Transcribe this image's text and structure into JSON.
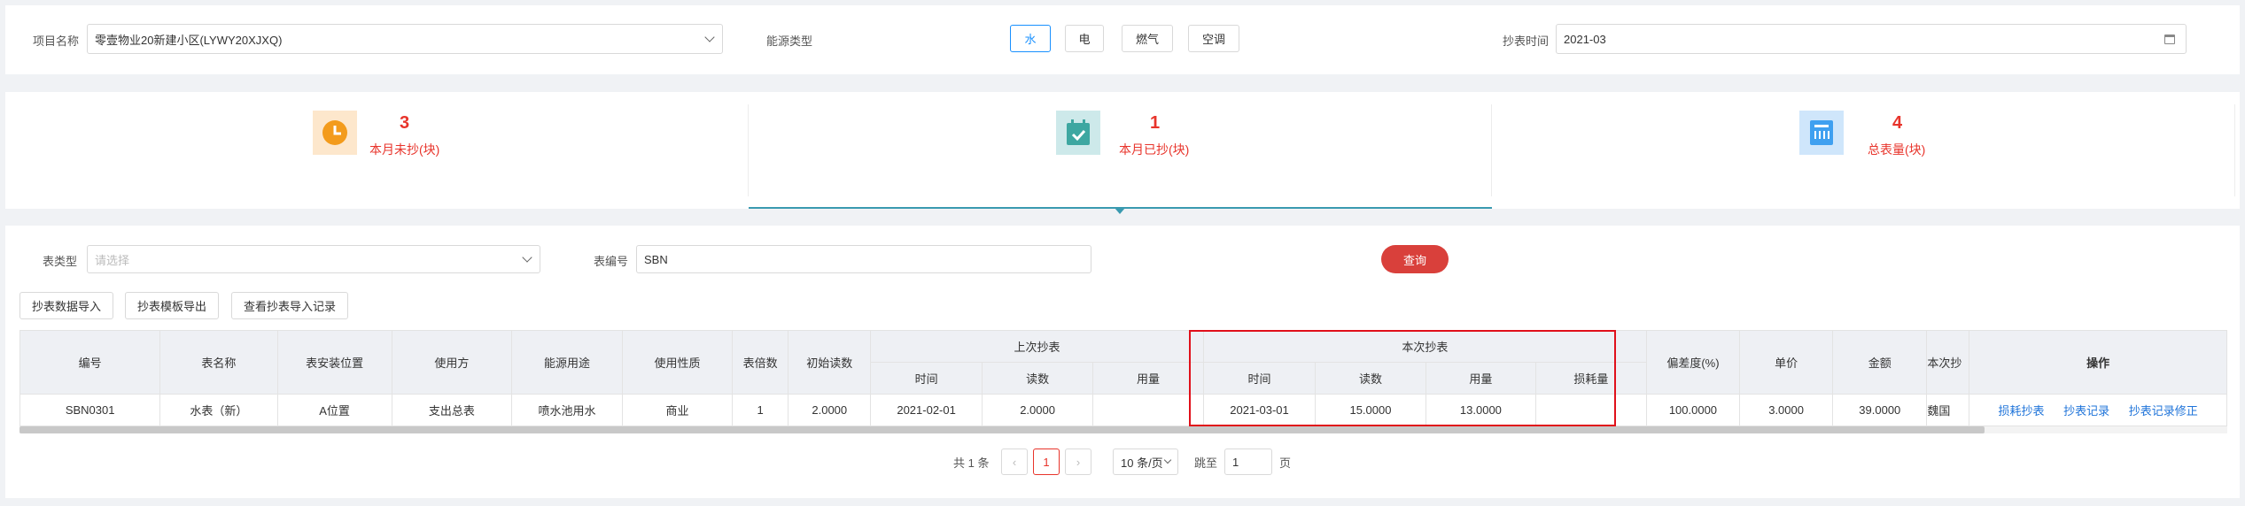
{
  "filters": {
    "project_label": "项目名称",
    "project_value": "零壹物业20新建小区(LYWY20XJXQ)",
    "energy_label": "能源类型",
    "energy_types": [
      "水",
      "电",
      "燃气",
      "空调"
    ],
    "energy_selected": "水",
    "read_time_label": "抄表时间",
    "read_time_value": "2021-03"
  },
  "stats": [
    {
      "value": "3",
      "label": "本月未抄(块)",
      "icon": "clock-icon",
      "color": "#f39b1c",
      "bg": "#fde7cc"
    },
    {
      "value": "1",
      "label": "本月已抄(块)",
      "icon": "calendar-check-icon",
      "color": "#3ea7a1",
      "bg": "#cde9ea"
    },
    {
      "value": "4",
      "label": "总表量(块)",
      "icon": "meter-icon",
      "color": "#3fa0f0",
      "bg": "#cfe6fb"
    }
  ],
  "search": {
    "meter_type_label": "表类型",
    "meter_type_placeholder": "请选择",
    "meter_no_label": "表编号",
    "meter_no_value": "SBN",
    "query_label": "查询"
  },
  "actions": [
    "抄表数据导入",
    "抄表模板导出",
    "查看抄表导入记录"
  ],
  "table": {
    "headers": {
      "code": "编号",
      "name": "表名称",
      "location": "表安装位置",
      "user": "使用方",
      "purpose": "能源用途",
      "nature": "使用性质",
      "multiplier": "表倍数",
      "init": "初始读数",
      "last_group": "上次抄表",
      "this_group": "本次抄表",
      "time": "时间",
      "reading": "读数",
      "usage": "用量",
      "loss": "损耗量",
      "deviation": "偏差度(%)",
      "price": "单价",
      "amount": "金额",
      "this_reader": "本次抄",
      "ops": "操作"
    },
    "rows": [
      {
        "code": "SBN0301",
        "name": "水表（新）",
        "location": "A位置",
        "user": "支出总表",
        "purpose": "喷水池用水",
        "nature": "商业",
        "multiplier": "1",
        "init": "2.0000",
        "last_time": "2021-02-01",
        "last_reading": "2.0000",
        "last_usage": "",
        "this_time": "2021-03-01",
        "this_reading": "15.0000",
        "this_usage": "13.0000",
        "this_loss": "",
        "deviation": "100.0000",
        "price": "3.0000",
        "amount": "39.0000",
        "reader": "魏国"
      }
    ],
    "row_ops": [
      "损耗抄表",
      "抄表记录",
      "抄表记录修正"
    ]
  },
  "pagination": {
    "total_text": "共 1 条",
    "current_page": "1",
    "page_size": "10 条/页",
    "goto_label": "跳至",
    "goto_value": "1",
    "page_suffix": "页"
  }
}
